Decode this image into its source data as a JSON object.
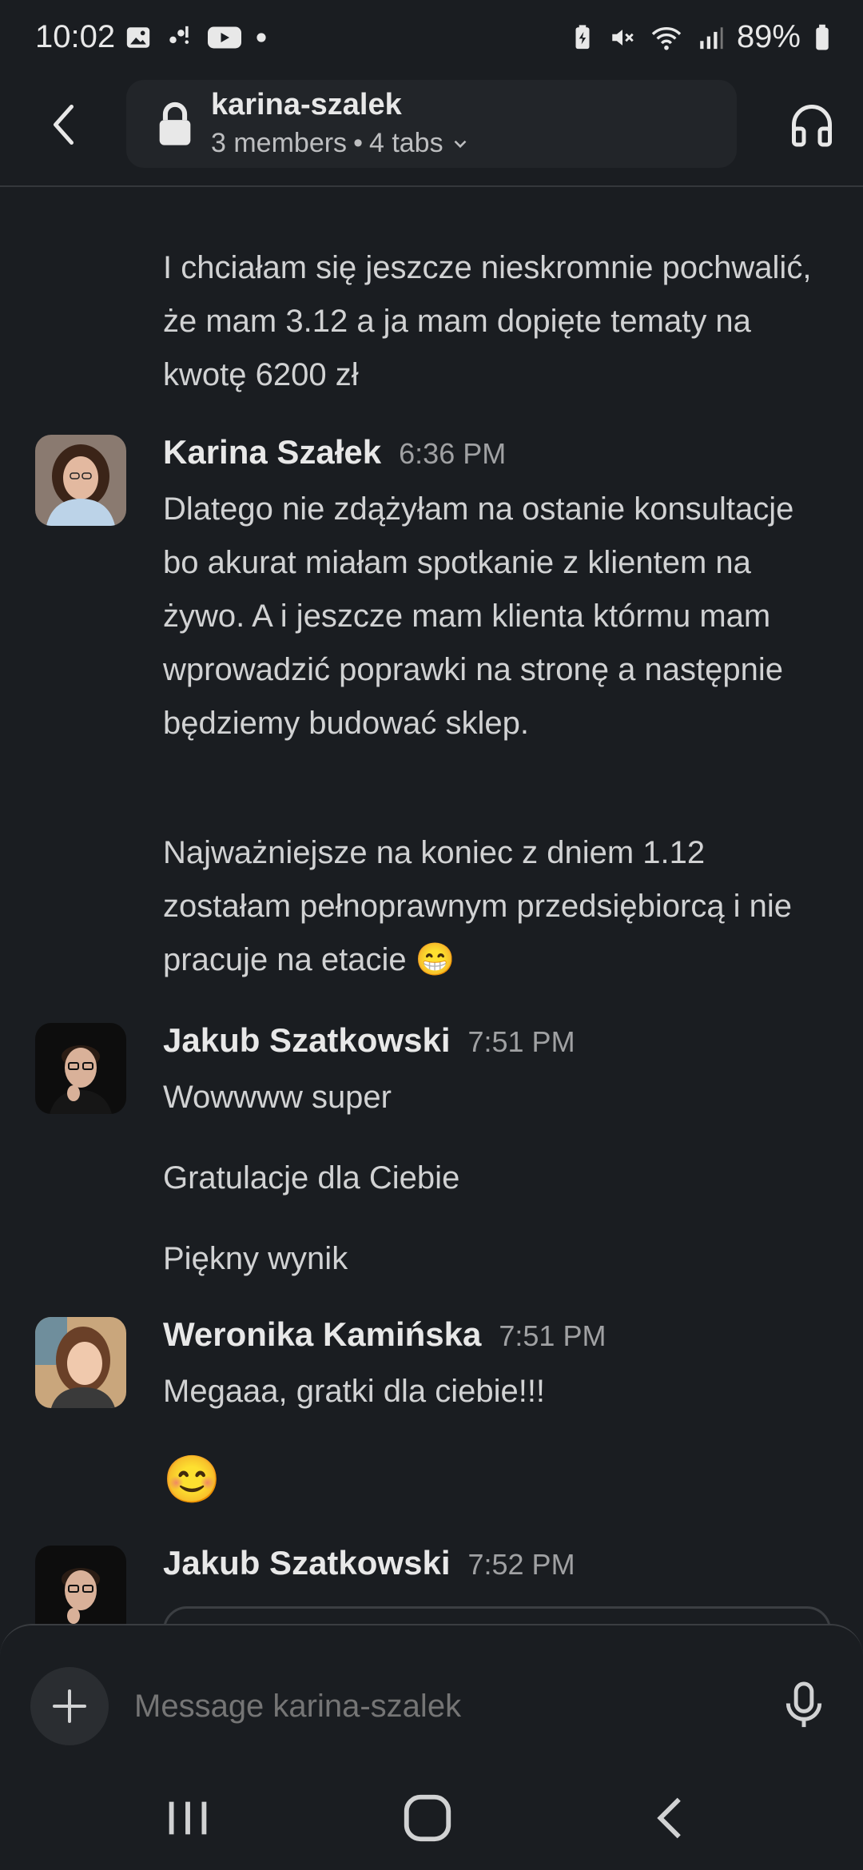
{
  "status_bar": {
    "time": "10:02",
    "battery": "89%",
    "left_icons": [
      "gallery-icon",
      "notification-dots-icon",
      "youtube-icon",
      "dot-icon"
    ],
    "right_icons": [
      "battery-saver-icon",
      "mute-icon",
      "wifi-icon",
      "signal-icon",
      "battery-icon"
    ]
  },
  "header": {
    "channel_name": "karina-szalek",
    "members": "3 members",
    "separator": "•",
    "tabs": "4 tabs"
  },
  "messages": {
    "m0": {
      "text": "I chciałam się jeszcze nieskromnie pochwalić, że mam 3.12 a ja mam dopięte tematy na kwotę 6200 zł"
    },
    "m1": {
      "author": "Karina Szałek",
      "time": "6:36 PM",
      "p1": "Dlatego nie zdążyłam na ostanie konsultacje bo akurat miałam spotkanie z klientem na żywo. A i jeszcze mam klienta którmu mam wprowadzić poprawki na stronę a następnie będziemy budować sklep.",
      "p2": "Najważniejsze na koniec z dniem 1.12 zostałam pełnoprawnym przedsiębiorcą i nie pracuje na etacie",
      "emoji": "😁"
    },
    "m2": {
      "author": "Jakub Szatkowski",
      "time": "7:51 PM",
      "p1": "Wowwww super",
      "p2": "Gratulacje dla Ciebie",
      "p3": "Piękny wynik"
    },
    "m3": {
      "author": "Weronika Kamińska",
      "time": "7:51 PM",
      "p1": "Megaaa, gratki dla ciebie!!!",
      "emoji": "😊"
    },
    "m4": {
      "author": "Jakub Szatkowski",
      "time": "7:52 PM"
    }
  },
  "composer": {
    "placeholder": "Message karina-szalek"
  },
  "colors": {
    "background": "#1a1d21",
    "text": "#d1d2d3",
    "muted": "#a0a1a3"
  }
}
